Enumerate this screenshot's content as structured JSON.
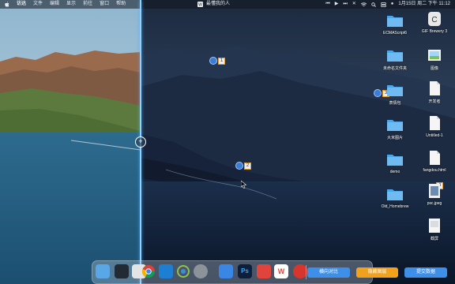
{
  "menubar": {
    "app_name": "访达",
    "menus": [
      "文件",
      "编辑",
      "显示",
      "前往",
      "窗口",
      "帮助"
    ],
    "center_title": "最懂我的人",
    "datetime": "1月15日 周二 下午 11:12",
    "icons": [
      "apple-icon",
      "music-app-icon",
      "prev-track-icon",
      "play-icon",
      "next-track-icon",
      "close-icon",
      "wifi-icon",
      "search-icon",
      "control-center-icon",
      "siri-icon"
    ]
  },
  "markers": [
    {
      "label": "1"
    },
    {
      "label": "2"
    },
    {
      "label": "3"
    },
    {
      "label": "4"
    }
  ],
  "desktop_icons": [
    {
      "label": "ECMAScript6",
      "icon": "folder-icon"
    },
    {
      "label": "GIF Brewery 3",
      "icon": "gif-brewery-app-icon"
    },
    {
      "label": "未命名文件夹",
      "icon": "folder-icon"
    },
    {
      "label": "图像",
      "icon": "image-file-icon"
    },
    {
      "label": "表情包",
      "icon": "folder-icon"
    },
    {
      "label": "开发者",
      "icon": "document-icon"
    },
    {
      "label": "大米图片",
      "icon": "folder-icon"
    },
    {
      "label": "Untitled-1",
      "icon": "document-icon"
    },
    {
      "label": "demo",
      "icon": "folder-icon"
    },
    {
      "label": "fangdou.html",
      "icon": "html-file-icon"
    },
    {
      "label": "Old_Homebrew",
      "icon": "folder-icon"
    },
    {
      "label": "psc.jpeg",
      "icon": "jpeg-file-icon"
    },
    {
      "label": "截屏",
      "icon": "screenshot-file-icon"
    }
  ],
  "dock": {
    "apps": [
      "finder-icon",
      "terminal-icon",
      "launchpad-icon",
      "chrome-icon",
      "vscode-icon",
      "script-editor-icon",
      "system-preferences-icon",
      "pen-app-icon",
      "photoshop-icon",
      "wps-icon",
      "wps-writer-icon",
      "netease-music-icon"
    ],
    "photoshop_label": "Ps",
    "wps_label": "W"
  },
  "actions": {
    "compare": "横向对比",
    "hide": "隐藏图层",
    "submit": "提交数据"
  },
  "colors": {
    "accent_blue": "#3e8fe8",
    "accent_orange": "#f2a11c",
    "split_line": "#8fd0ff"
  }
}
